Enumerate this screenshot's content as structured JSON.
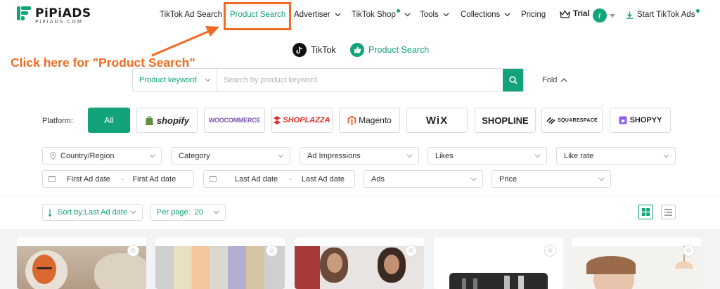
{
  "brand": {
    "name": "PiPiADS",
    "sub": "PIPIADS.COM",
    "color": "#13a37a"
  },
  "nav": {
    "items": [
      {
        "label": "TikTok Ad Search"
      },
      {
        "label": "Product Search"
      },
      {
        "label": "Advertiser"
      },
      {
        "label": "TikTok Shop"
      },
      {
        "label": "Tools"
      },
      {
        "label": "Collections"
      },
      {
        "label": "Pricing"
      }
    ],
    "trial_label": "Trial",
    "avatar_letter": "r",
    "start_label": "Start TikTok Ads"
  },
  "annotation": {
    "text": "Click here for \"Product Search\"",
    "color": "#ef6b22"
  },
  "source_switch": {
    "tiktok_label": "TikTok",
    "product_label": "Product Search"
  },
  "search": {
    "type_value": "Product keyword",
    "placeholder": "Search by product keyword",
    "fold_label": "Fold"
  },
  "platform": {
    "label": "Platform:",
    "options": [
      "All",
      "shopify",
      "WOOCOMMERCE",
      "SHOPLAZZA",
      "Magento",
      "WiX",
      "SHOPLINE",
      "SQUARESPACE",
      "SHOPYY"
    ]
  },
  "filters": {
    "row1": [
      "Country/Region",
      "Category",
      "Ad Impressions",
      "Likes",
      "Like rate"
    ],
    "first_ad_date": {
      "from": "First Ad date",
      "to": "First Ad date"
    },
    "last_ad_date": {
      "from": "Last Ad date",
      "to": "Last Ad date"
    },
    "ads": "Ads",
    "price": "Price"
  },
  "toolbar": {
    "sort_label": "Sort by:Last Ad date",
    "per_page_label": "Per page:",
    "per_page_value": "20"
  },
  "cards": [
    {
      "icon": "star-icon"
    },
    {
      "icon": "star-icon"
    },
    {
      "icon": "star-icon"
    },
    {
      "icon": "star-icon"
    },
    {
      "icon": "star-icon"
    }
  ]
}
